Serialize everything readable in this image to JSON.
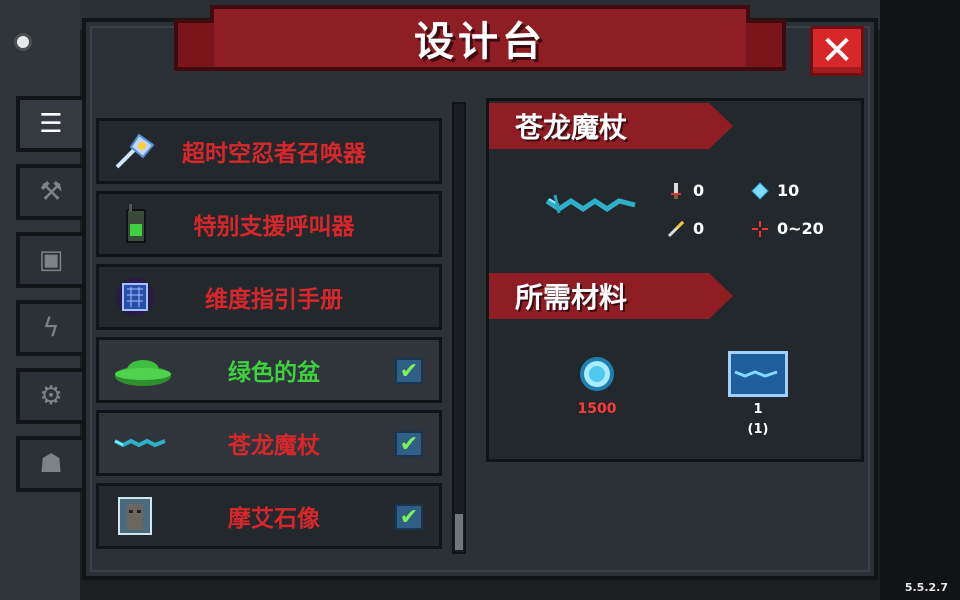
{
  "window": {
    "title": "设计台",
    "close_icon": "close-icon"
  },
  "tabs": [
    {
      "icon": "list-icon",
      "glyph": "☰",
      "active": true
    },
    {
      "icon": "weapon-icon",
      "glyph": "⚒",
      "active": false
    },
    {
      "icon": "armor-icon",
      "glyph": "▣",
      "active": false
    },
    {
      "icon": "lightning-icon",
      "glyph": "ϟ",
      "active": false
    },
    {
      "icon": "gear-icon",
      "glyph": "⚙",
      "active": false
    },
    {
      "icon": "character-icon",
      "glyph": "☗",
      "active": false
    }
  ],
  "items": [
    {
      "label": "超时空忍者召唤器",
      "icon": "scepter-icon",
      "checked": false,
      "color": "#d8272b"
    },
    {
      "label": "特别支援呼叫器",
      "icon": "walkie-talkie-icon",
      "checked": false,
      "color": "#d8272b"
    },
    {
      "label": "维度指引手册",
      "icon": "manual-icon",
      "checked": false,
      "color": "#d8272b"
    },
    {
      "label": "绿色的盆",
      "icon": "green-bowl-icon",
      "checked": true,
      "color": "#3fcf3f"
    },
    {
      "label": "苍龙魔杖",
      "icon": "dragon-staff-icon",
      "checked": true,
      "color": "#d8272b"
    },
    {
      "label": "摩艾石像",
      "icon": "moai-statue-icon",
      "checked": true,
      "color": "#d8272b"
    }
  ],
  "detail": {
    "name": "苍龙魔杖",
    "stats": {
      "damage": "0",
      "energy": "10",
      "crit": "0",
      "spread": "0~20"
    },
    "materials_title": "所需材料",
    "materials": [
      {
        "icon": "gem-icon",
        "count": "1500"
      },
      {
        "icon": "blueprint-icon",
        "count": "1",
        "owned": "(1)"
      }
    ]
  },
  "version": "5.5.2.7",
  "colors": {
    "accent_red": "#8e1e24",
    "text_red": "#d8272b",
    "text_green": "#3fcf3f",
    "check_blue": "#2f5e86"
  }
}
